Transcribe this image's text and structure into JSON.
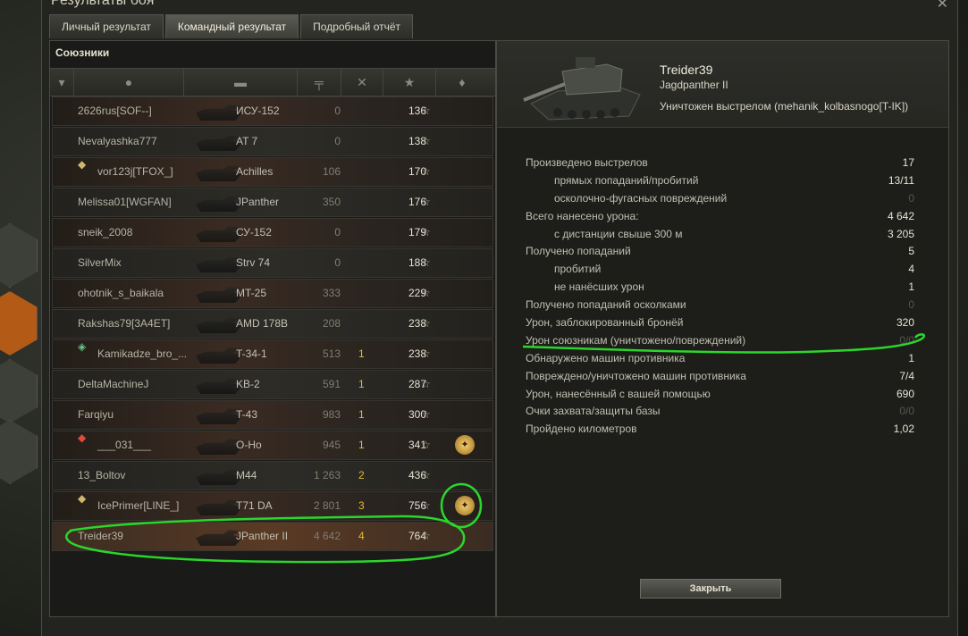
{
  "window": {
    "title": "Результаты боя",
    "tabs": [
      {
        "label": "Личный результат"
      },
      {
        "label": "Командный результат"
      },
      {
        "label": "Подробный отчёт"
      }
    ]
  },
  "allies": {
    "title": "Союзники",
    "rows": [
      {
        "player": "2626rus[SOF--]",
        "tank": "ИСУ-152",
        "damage": "0",
        "kills": "",
        "xp": "136"
      },
      {
        "player": "Nevalyashka777",
        "tank": "AT 7",
        "damage": "0",
        "kills": "",
        "xp": "138"
      },
      {
        "player": "vor123j[TFOX_]",
        "tank": "Achilles",
        "damage": "106",
        "kills": "",
        "xp": "170"
      },
      {
        "player": "Melissa01[WGFAN]",
        "tank": "JPanther",
        "damage": "350",
        "kills": "",
        "xp": "176"
      },
      {
        "player": "sneik_2008",
        "tank": "СУ-152",
        "damage": "0",
        "kills": "",
        "xp": "179"
      },
      {
        "player": "SilverMix",
        "tank": "Strv 74",
        "damage": "0",
        "kills": "",
        "xp": "188"
      },
      {
        "player": "ohotnik_s_baikala",
        "tank": "MT-25",
        "damage": "333",
        "kills": "",
        "xp": "229"
      },
      {
        "player": "Rakshas79[3A4ET]",
        "tank": "AMD 178B",
        "damage": "208",
        "kills": "",
        "xp": "238"
      },
      {
        "player": "Kamikadze_bro_...",
        "tank": "T-34-1",
        "damage": "513",
        "kills": "1",
        "xp": "238"
      },
      {
        "player": "DeltaMachineJ",
        "tank": "KB-2",
        "damage": "591",
        "kills": "1",
        "xp": "287"
      },
      {
        "player": "Farqiyu",
        "tank": "T-43",
        "damage": "983",
        "kills": "1",
        "xp": "300"
      },
      {
        "player": "___031___",
        "tank": "O-Ho",
        "damage": "945",
        "kills": "1",
        "xp": "341"
      },
      {
        "player": "13_Boltov",
        "tank": "M44",
        "damage": "1 263",
        "kills": "2",
        "xp": "436"
      },
      {
        "player": "IcePrimer[LINE_]",
        "tank": "T71 DA",
        "damage": "2 801",
        "kills": "3",
        "xp": "756"
      },
      {
        "player": "Treider39",
        "tank": "JPanther II",
        "damage": "4 642",
        "kills": "4",
        "xp": "764"
      }
    ]
  },
  "player": {
    "nick": "Treider39",
    "tank": "Jagdpanther II",
    "death": "Уничтожен выстрелом (mehanik_kolbasnogo[T-IK])"
  },
  "stats": [
    {
      "label": "Произведено выстрелов",
      "value": "17"
    },
    {
      "label": "прямых попаданий/пробитий",
      "value": "13/11"
    },
    {
      "label": "осколочно-фугасных повреждений",
      "value": "0"
    },
    {
      "label": "Всего нанесено урона:",
      "value": "4 642"
    },
    {
      "label": "с дистанции свыше 300 м",
      "value": "3 205"
    },
    {
      "label": "Получено попаданий",
      "value": "5"
    },
    {
      "label": "пробитий",
      "value": "4"
    },
    {
      "label": "не нанёсших урон",
      "value": "1"
    },
    {
      "label": "Получено попаданий осколками",
      "value": "0"
    },
    {
      "label": "Урон, заблокированный бронёй",
      "value": "320"
    },
    {
      "label": "Урон союзникам (уничтожено/повреждений)",
      "value": "0/0"
    },
    {
      "label": "Обнаружено машин противника",
      "value": "1"
    },
    {
      "label": "Повреждено/уничтожено машин противника",
      "value": "7/4"
    },
    {
      "label": "Урон, нанесённый с вашей помощью",
      "value": "690"
    },
    {
      "label": "Очки захвата/защиты базы",
      "value": "0/0"
    },
    {
      "label": "Пройдено километров",
      "value": "1,02"
    }
  ],
  "buttons": {
    "close": "Закрыть"
  },
  "colors": {
    "annotation": "#2bd62b",
    "kills": "#e0b83b",
    "accent_orange": "#b35a17"
  }
}
